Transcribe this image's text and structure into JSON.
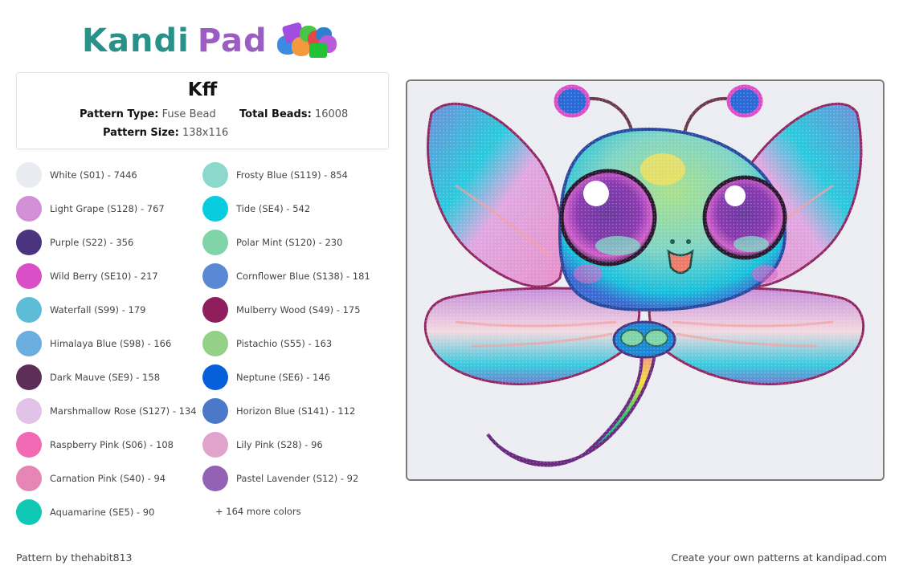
{
  "brand": {
    "name_part1": "Kandi",
    "name_part2": "Pad",
    "colors": {
      "kandi": "#2a9188",
      "pad": "#9b5cc4"
    }
  },
  "pattern": {
    "title": "Kff",
    "type_label": "Pattern Type:",
    "type_value": "Fuse Bead",
    "total_label": "Total Beads:",
    "total_value": "16008",
    "size_label": "Pattern Size:",
    "size_value": "138x116",
    "image_description": "Cute rainbow dragonfly with big sparkly eyes, pink and blue wings, and a rainbow segmented tail",
    "background_color": "#ebedf2"
  },
  "colors_left": [
    {
      "label": "White (S01) - 7446",
      "hex": "#e8ebf0"
    },
    {
      "label": "Light Grape (S128) - 767",
      "hex": "#d490d6"
    },
    {
      "label": "Purple (S22) - 356",
      "hex": "#4a347f"
    },
    {
      "label": "Wild Berry (SE10) - 217",
      "hex": "#d94fc8"
    },
    {
      "label": "Waterfall (S99) - 179",
      "hex": "#5dbcd8"
    },
    {
      "label": "Himalaya Blue (S98) - 166",
      "hex": "#6aaee0"
    },
    {
      "label": "Dark Mauve (SE9) - 158",
      "hex": "#5c2e58"
    },
    {
      "label": "Marshmallow Rose (S127) - 134",
      "hex": "#e0c3e6"
    },
    {
      "label": "Raspberry Pink (S06) - 108",
      "hex": "#f06ab4"
    },
    {
      "label": "Carnation Pink (S40) - 94",
      "hex": "#e586b4"
    },
    {
      "label": "Aquamarine (SE5) - 90",
      "hex": "#10c8b4"
    }
  ],
  "colors_right": [
    {
      "label": "Frosty Blue (S119) - 854",
      "hex": "#8cd8cc"
    },
    {
      "label": "Tide (SE4) - 542",
      "hex": "#08cce0"
    },
    {
      "label": "Polar Mint (S120) - 230",
      "hex": "#7fd4a8"
    },
    {
      "label": "Cornflower Blue (S138) - 181",
      "hex": "#5a88d4"
    },
    {
      "label": "Mulberry Wood (S49) - 175",
      "hex": "#8e1e5c"
    },
    {
      "label": "Pistachio (S55) - 163",
      "hex": "#94d086"
    },
    {
      "label": "Neptune (SE6) - 146",
      "hex": "#0660dc"
    },
    {
      "label": "Horizon Blue (S141) - 112",
      "hex": "#4c78c8"
    },
    {
      "label": "Lily Pink (S28) - 96",
      "hex": "#e0a4cc"
    },
    {
      "label": "Pastel Lavender (S12) - 92",
      "hex": "#9462b4"
    }
  ],
  "more_colors": "+ 164 more colors",
  "footer": {
    "author": "Pattern by thehabit813",
    "cta": "Create your own patterns at kandipad.com"
  }
}
